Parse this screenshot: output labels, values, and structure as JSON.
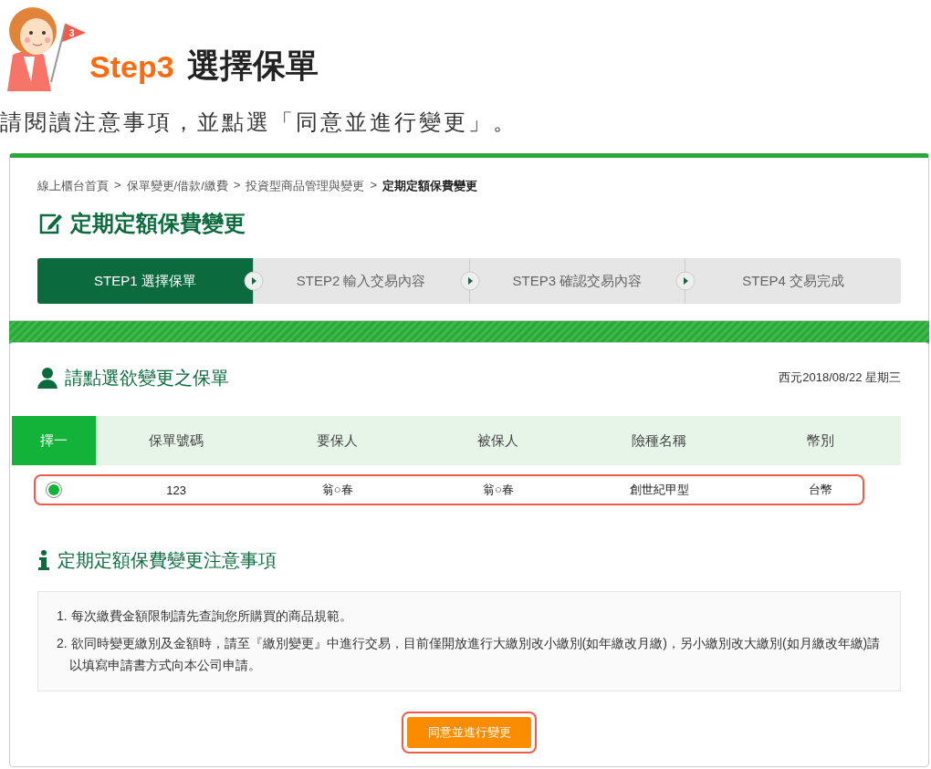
{
  "header": {
    "flag_number": "3",
    "step": "Step3",
    "title": "選擇保單",
    "instruction": "請閱讀注意事項，並點選「同意並進行變更」。"
  },
  "breadcrumb": [
    {
      "label": "線上櫃台首頁",
      "current": false
    },
    {
      "label": "保單變更/借款/繳費",
      "current": false
    },
    {
      "label": "投資型商品管理與變更",
      "current": false
    },
    {
      "label": "定期定額保費變更",
      "current": true
    }
  ],
  "breadcrumb_separator": ">",
  "page_title": "定期定額保費變更",
  "steps": [
    {
      "label": "STEP1 選擇保單",
      "selected": true
    },
    {
      "label": "STEP2 輸入交易內容",
      "selected": false
    },
    {
      "label": "STEP3 確認交易內容",
      "selected": false
    },
    {
      "label": "STEP4 交易完成",
      "selected": false
    }
  ],
  "policy_section": {
    "title": "請點選欲變更之保單",
    "date": "西元2018/08/22 星期三"
  },
  "table": {
    "select_column": "擇一",
    "columns": [
      "保單號碼",
      "要保人",
      "被保人",
      "險種名稱",
      "幣別"
    ],
    "rows": [
      {
        "selected": true,
        "highlighted": true,
        "cells": [
          "123",
          "翁○春",
          "翁○春",
          "創世紀甲型",
          "台幣"
        ]
      }
    ]
  },
  "notes": {
    "title": "定期定額保費變更注意事項",
    "items": [
      "1. 每次繳費金額限制請先查詢您所購買的商品規範。",
      "2. 欲同時變更繳別及金額時，請至『繳別變更』中進行交易，目前僅開放進行大繳別改小繳別(如年繳改月繳)，另小繳別改大繳別(如月繳改年繳)請以填寫申請書方式向本公司申請。"
    ]
  },
  "agree_button": {
    "label": "同意並進行變更",
    "highlighted": true
  }
}
